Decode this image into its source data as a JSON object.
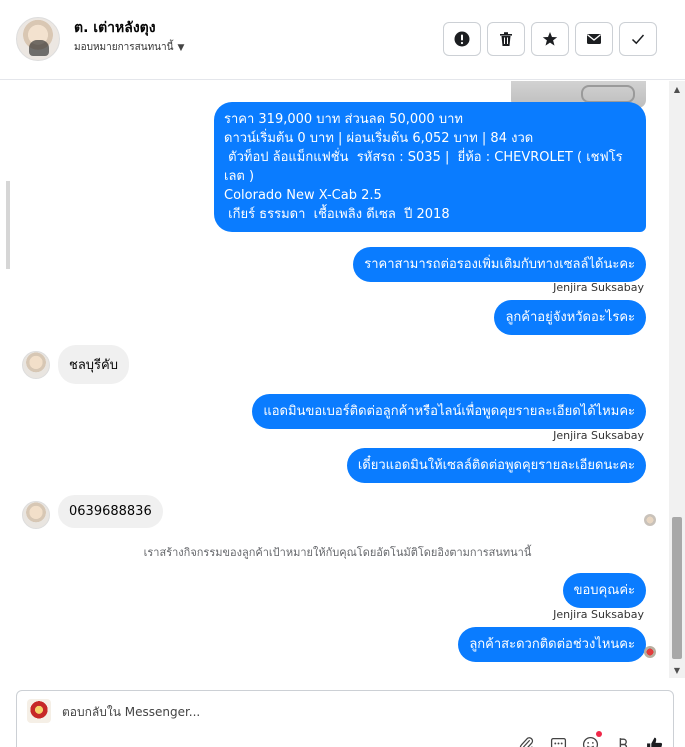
{
  "header": {
    "contact_name": "ต. เต่าหลังตุง",
    "assign_label": "มอบหมายการสนทนานี้",
    "buttons": [
      {
        "name": "report-button",
        "icon": "exclamation-icon"
      },
      {
        "name": "delete-button",
        "icon": "trash-icon"
      },
      {
        "name": "star-button",
        "icon": "star-icon"
      },
      {
        "name": "mark-unread-button",
        "icon": "envelope-icon"
      },
      {
        "name": "mark-done-button",
        "icon": "check-icon"
      }
    ]
  },
  "messages": {
    "car_offer": {
      "lines": [
        "ราคา 319,000 บาท ส่วนลด 50,000 บาท",
        "ดาวน์เริ่มต้น 0 บาท | ผ่อนเริ่มต้น 6,052 บาท | 84 งวด",
        " ตัวท็อป ล้อแม็กแฟชั่น  รหัสรถ : S035 |  ยี่ห้อ : CHEVROLET ( เชฟโร",
        "เลต )",
        "Colorado New X-Cab 2.5",
        " เกียร์ ธรรมดา  เชื้อเพลิง ดีเซล  ปี 2018"
      ]
    },
    "out_1": "ราคาสามารถต่อรองเพิ่มเติมกับทางเซลล์ได้นะคะ",
    "sender_1": "Jenjira Suksabay",
    "out_2": "ลูกค้าอยู่จังหวัดอะไรคะ",
    "in_1": "ชลบุรีคับ",
    "out_3": "แอดมินขอเบอร์ติดต่อลูกค้าหรือไลน์เพื่อพูดคุยรายละเอียดได้ไหมคะ",
    "sender_2": "Jenjira Suksabay",
    "out_4": "เดี๋ยวแอดมินให้เซลล์ติดต่อพูดคุยรายละเอียดนะคะ",
    "in_2": "0639688836",
    "system_note": "เราสร้างกิจกรรมของลูกค้าเป้าหมายให้กับคุณโดยอัตโนมัติโดยอิงตามการสนทนานี้",
    "out_5": "ขอบคุณค่ะ",
    "sender_3": "Jenjira Suksabay",
    "out_6": "ลูกค้าสะดวกติดต่อช่วงไหนคะ"
  },
  "composer": {
    "placeholder": "ตอบกลับใน Messenger...",
    "tools": [
      "paperclip-icon",
      "saved-reply-icon",
      "emoji-icon",
      "currency-icon",
      "like-icon"
    ]
  },
  "colors": {
    "outgoing_bubble": "#0a7cff",
    "incoming_bubble": "#f0f0f0",
    "notification_dot": "#f02849"
  }
}
